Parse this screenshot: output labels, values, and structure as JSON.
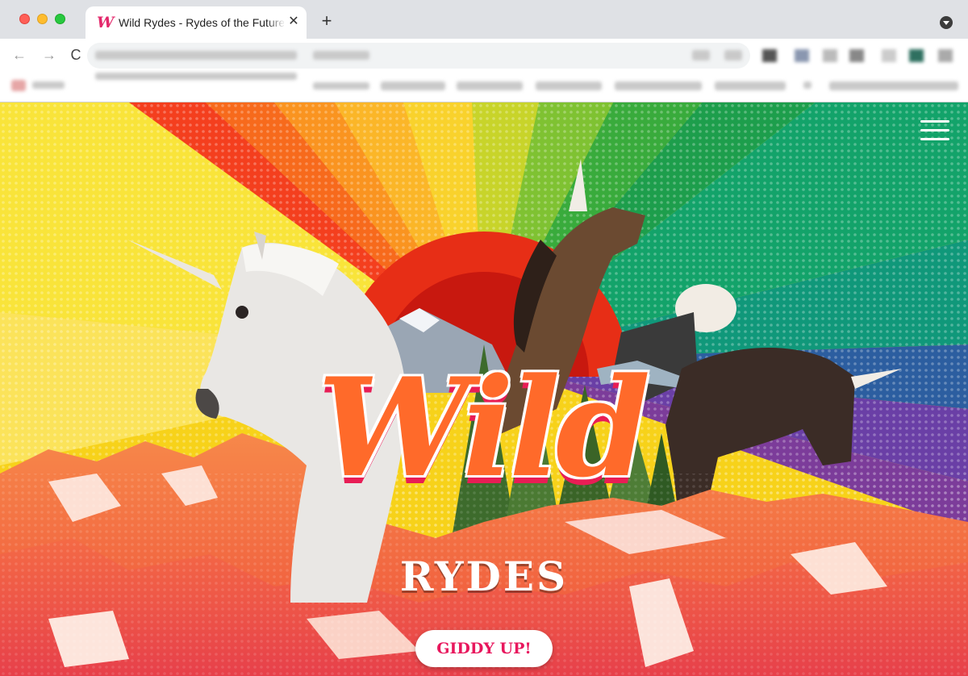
{
  "browser": {
    "tab": {
      "title": "Wild Rydes - Rydes of the Future",
      "favicon_letter": "W",
      "close_glyph": "✕"
    },
    "new_tab_glyph": "+",
    "nav": {
      "back_glyph": "←",
      "forward_glyph": "→",
      "reload_glyph": "C"
    }
  },
  "hero": {
    "logo_primary": "Wild",
    "logo_secondary": "RYDES",
    "cta_label": "GIDDY UP!"
  },
  "colors": {
    "accent": "#e8175d",
    "logo_orange": "#ff6a2a",
    "mountains": "#f2673a"
  },
  "icons": [
    "favicon-w-icon",
    "close-icon",
    "plus-icon",
    "back-arrow-icon",
    "forward-arrow-icon",
    "reload-icon",
    "tab-menu-icon",
    "hamburger-menu-icon"
  ]
}
